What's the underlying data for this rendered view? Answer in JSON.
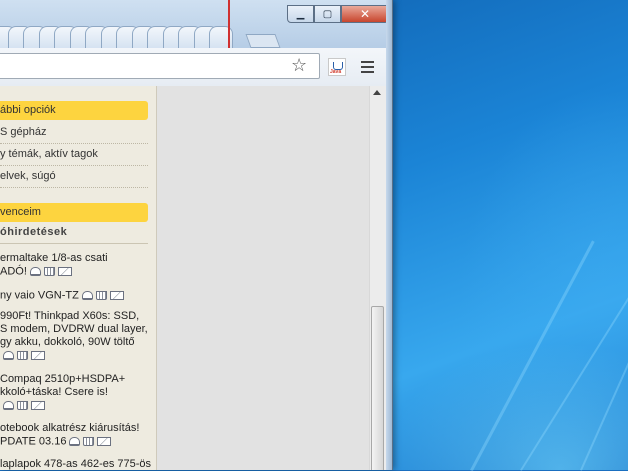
{
  "window": {
    "caption": {
      "minimize": "▁",
      "maximize": "▢",
      "close": "✕"
    }
  },
  "toolbar": {
    "bookmark_icon": "star-icon",
    "extension_icon": "java-icon",
    "extension_label": "Java",
    "menu_icon": "hamburger-menu-icon"
  },
  "sidebar": {
    "sections": [
      {
        "label": "ábbi opciók"
      },
      {
        "label": "venceim"
      }
    ],
    "menu_links": [
      "S gépház",
      "y témák, aktív tagok",
      "elvek, súgó"
    ],
    "ads_title": "óhirdetések",
    "ads": [
      {
        "lines": [
          "ermaltake 1/8-as csati",
          "ADÓ!"
        ]
      },
      {
        "lines": [
          "ny vaio VGN-TZ"
        ]
      },
      {
        "lines": [
          "990Ft! Thinkpad X60s: SSD,",
          "S modem, DVDRW dual layer,",
          "gy akku, dokkoló, 90W töltő",
          ""
        ]
      },
      {
        "lines": [
          " Compaq 2510p+HSDPA+",
          "kkoló+táska! Csere is!",
          ""
        ]
      },
      {
        "lines": [
          "otebook alkatrész kiárusítás!",
          "PDATE 03.16"
        ]
      },
      {
        "lines": [
          "laplapok 478-as 462-es 775-ös"
        ]
      }
    ]
  },
  "colors": {
    "section_header": "#fdd43f",
    "sidebar_bg": "#eeebe0",
    "content_bg": "#e2e2e2",
    "close_button": "#c8452d"
  }
}
